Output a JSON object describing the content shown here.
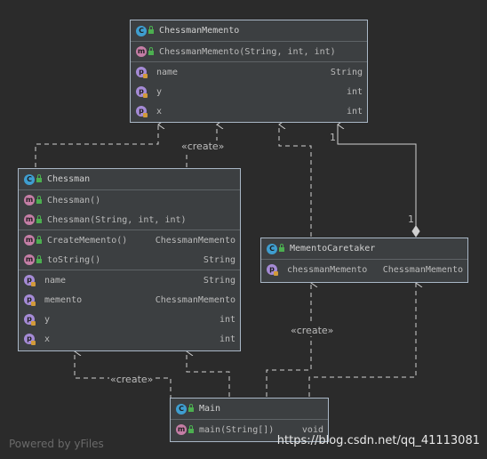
{
  "classes": {
    "chessman_memento": {
      "name": "ChessmanMemento",
      "kind": "C",
      "constructors": [
        {
          "kind": "m",
          "name": "ChessmanMemento(String, int, int)",
          "type": ""
        }
      ],
      "fields": [
        {
          "kind": "p",
          "name": "name",
          "type": "String"
        },
        {
          "kind": "p",
          "name": "y",
          "type": "int"
        },
        {
          "kind": "p",
          "name": "x",
          "type": "int"
        }
      ]
    },
    "chessman": {
      "name": "Chessman",
      "kind": "C",
      "constructors": [
        {
          "kind": "m",
          "name": "Chessman()",
          "type": ""
        },
        {
          "kind": "m",
          "name": "Chessman(String, int, int)",
          "type": ""
        }
      ],
      "methods": [
        {
          "kind": "m",
          "name": "CreateMemento()",
          "type": "ChessmanMemento"
        },
        {
          "kind": "m",
          "name": "toString()",
          "type": "String"
        }
      ],
      "fields": [
        {
          "kind": "p",
          "name": "name",
          "type": "String"
        },
        {
          "kind": "p",
          "name": "memento",
          "type": "ChessmanMemento"
        },
        {
          "kind": "p",
          "name": "y",
          "type": "int"
        },
        {
          "kind": "p",
          "name": "x",
          "type": "int"
        }
      ]
    },
    "memento_caretaker": {
      "name": "MementoCaretaker",
      "kind": "C",
      "fields": [
        {
          "kind": "p",
          "name": "chessmanMemento",
          "type": "ChessmanMemento"
        }
      ]
    },
    "main": {
      "name": "Main",
      "kind": "C",
      "methods": [
        {
          "kind": "m",
          "name": "main(String[])",
          "type": "void"
        }
      ]
    }
  },
  "relations": {
    "create_label_top": "«create»",
    "create_label_right": "«create»",
    "create_label_bottom": "«create»",
    "multiplicity_memento_end": "1",
    "multiplicity_caretaker_end": "1"
  },
  "colors": {
    "background": "#2b2b2b",
    "class_fill": "#3c3f41",
    "class_border": "#a9b7c6",
    "badge_class": "#3f9ed0",
    "badge_method": "#c57ea6",
    "badge_field": "#a58bd6"
  },
  "footer": {
    "powered_by": "Powered by yFiles",
    "watermark": "https://blog.csdn.net/qq_41113081"
  }
}
